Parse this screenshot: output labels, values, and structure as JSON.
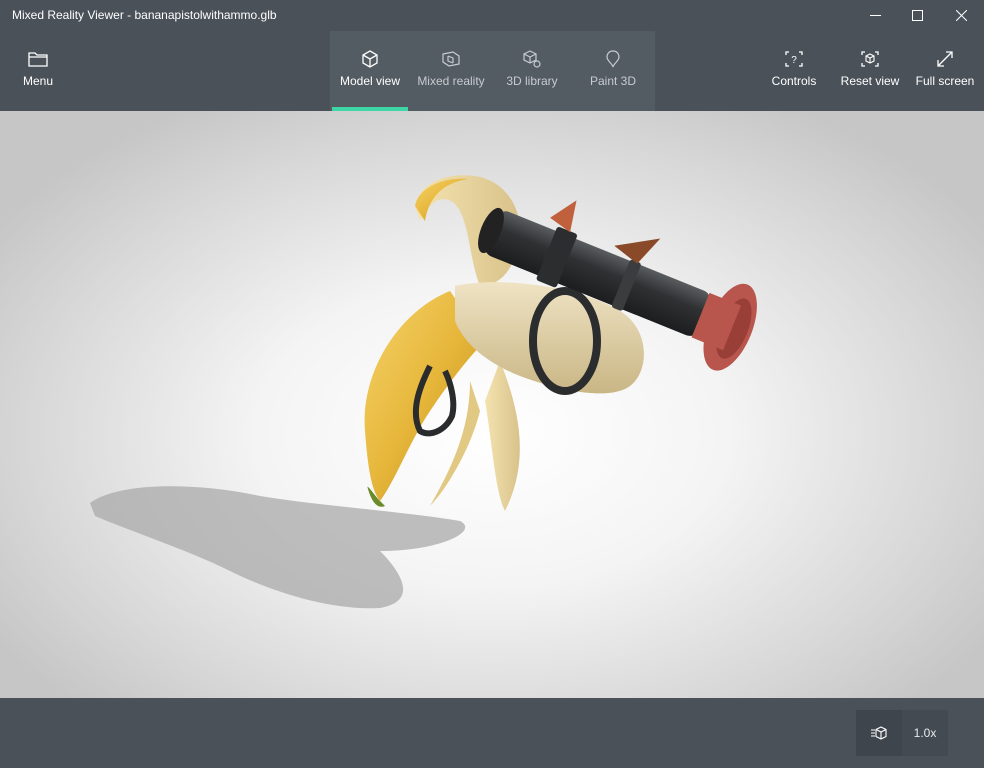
{
  "window": {
    "title": "Mixed Reality Viewer - bananapistolwithammo.glb"
  },
  "toolbar": {
    "menu": {
      "label": "Menu",
      "icon": "folder-icon"
    },
    "tabs": [
      {
        "label": "Model view",
        "icon": "cube-icon",
        "active": true
      },
      {
        "label": "Mixed reality",
        "icon": "mixed-reality-icon",
        "active": false
      },
      {
        "label": "3D library",
        "icon": "library-icon",
        "active": false
      },
      {
        "label": "Paint 3D",
        "icon": "paint-3d-icon",
        "active": false
      }
    ],
    "controls": {
      "label": "Controls",
      "icon": "controls-icon"
    },
    "reset_view": {
      "label": "Reset view",
      "icon": "reset-view-icon"
    },
    "full_screen": {
      "label": "Full screen",
      "icon": "full-screen-icon"
    }
  },
  "bottom": {
    "animation_icon": "animation-icon",
    "speed": "1.0x"
  },
  "colors": {
    "chrome": "#4a5159",
    "accent": "#3fd6a6"
  }
}
